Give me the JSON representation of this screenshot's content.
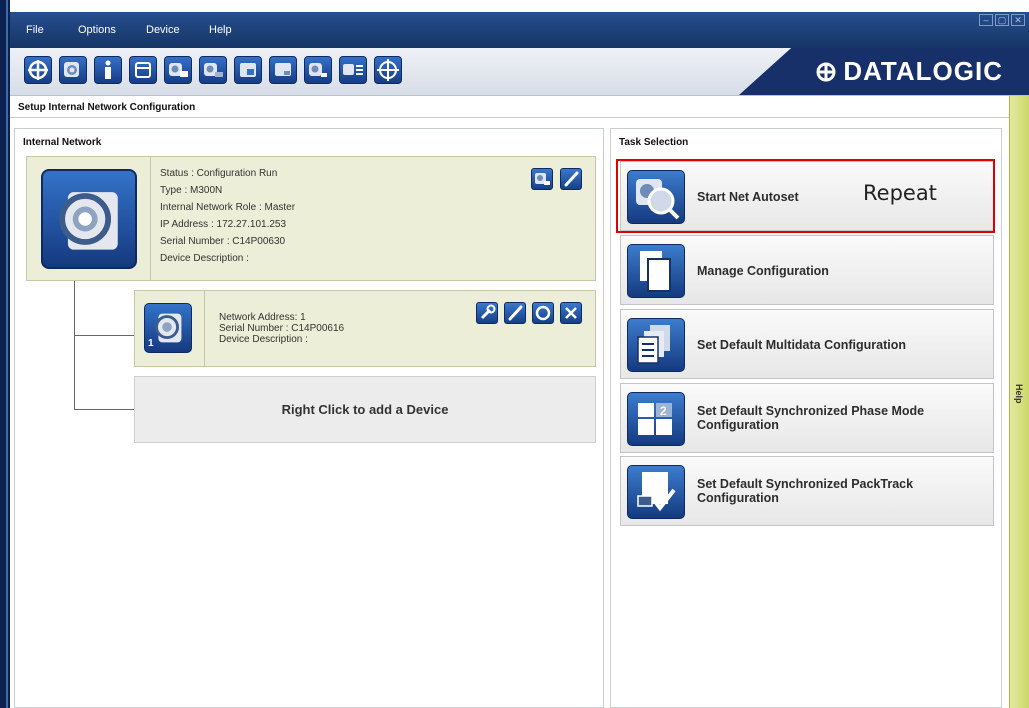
{
  "menu": [
    "File",
    "Options",
    "Device",
    "Help"
  ],
  "window_controls": [
    "minimize-icon",
    "restore-icon",
    "close-icon"
  ],
  "toolbar_icons": [
    "crosshair-icon",
    "device-scan-icon",
    "info-icon",
    "window-icon",
    "device-settings-icon",
    "device-export-icon",
    "save-to-device-icon",
    "monitor-icon",
    "device-list-icon",
    "diagnostics-icon",
    "target-icon"
  ],
  "brand": "DATALOGIC",
  "page_title": "Setup Internal Network Configuration",
  "internal_network": {
    "title": "Internal Network",
    "master": {
      "status": "Status : Configuration Run",
      "type": "Type : M300N",
      "role": "Internal Network Role : Master",
      "ip": "IP Address : 172.27.101.253",
      "serial": "Serial Number : C14P00630",
      "description": "Device Description :"
    },
    "slave": {
      "badge": "1",
      "network_address": "Network Address: 1",
      "serial": "Serial Number : C14P00616",
      "description": "Device Description :"
    },
    "add_device": "Right Click to add a Device"
  },
  "task_selection": {
    "title": "Task Selection",
    "tasks": [
      {
        "label": "Start Net Autoset",
        "icon": "net-autoset-icon"
      },
      {
        "label": "Manage Configuration",
        "icon": "document-copy-icon"
      },
      {
        "label": "Set Default Multidata Configuration",
        "icon": "multidata-icon"
      },
      {
        "label": "Set Default Synchronized Phase Mode Configuration",
        "icon": "phase-mode-icon"
      },
      {
        "label": "Set Default Synchronized PackTrack Configuration",
        "icon": "packtrack-icon"
      }
    ],
    "annotation": "Repeat"
  },
  "help_label": "Help",
  "colors": {
    "menubar": "#1d3f7a",
    "highlight": "#e00000",
    "card": "#eceed7",
    "help_rail": "#d4de7e"
  }
}
